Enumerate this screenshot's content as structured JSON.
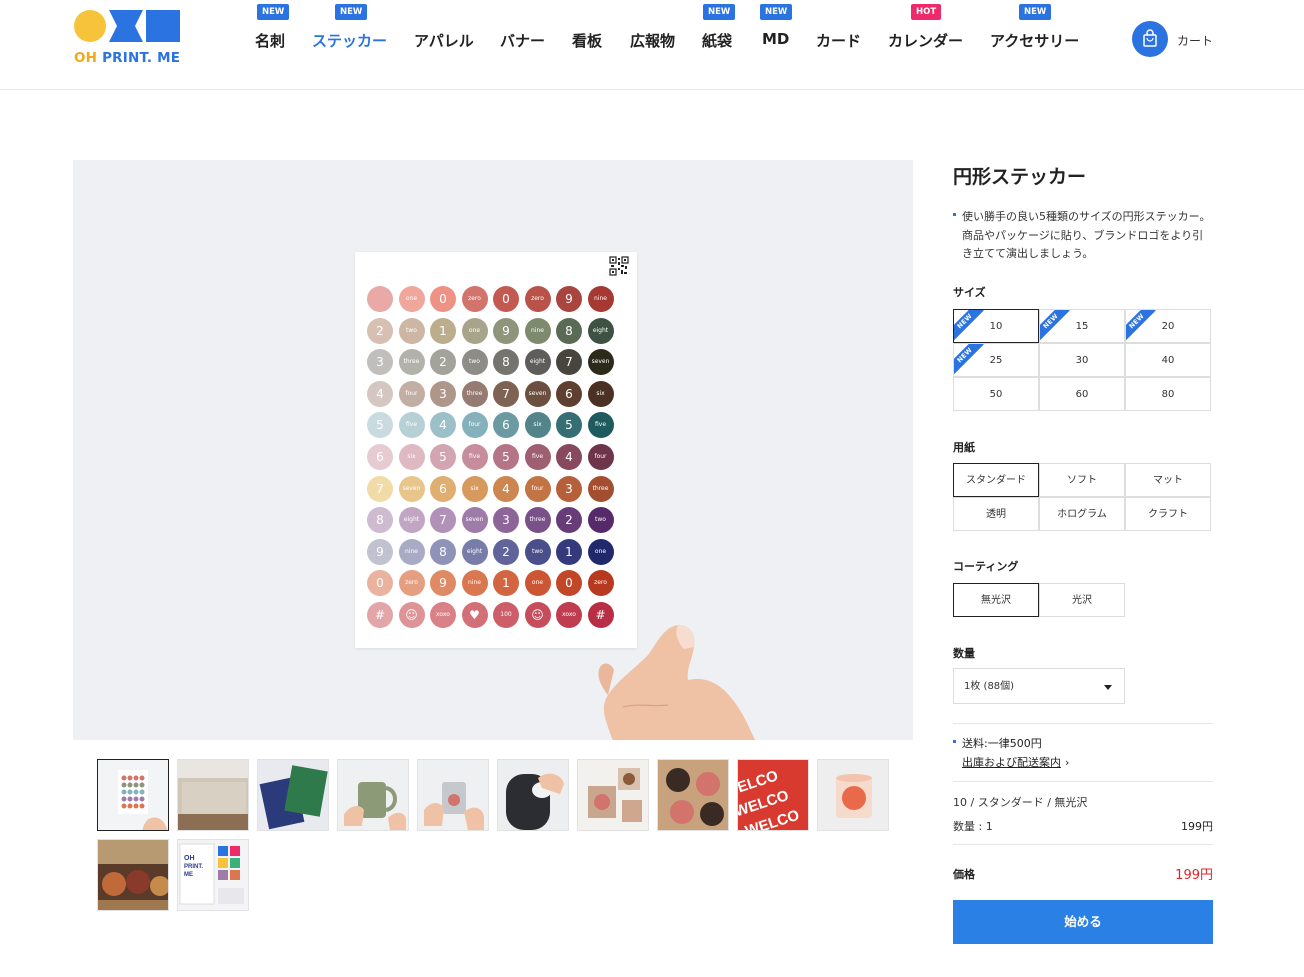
{
  "header": {
    "logo": {
      "oh": "OH ",
      "printme": "PRINT. ME"
    },
    "nav": [
      {
        "label": "名刺",
        "badge": "NEW"
      },
      {
        "label": "ステッカー",
        "badge": "NEW",
        "active": true
      },
      {
        "label": "アパレル",
        "badge": ""
      },
      {
        "label": "バナー",
        "badge": ""
      },
      {
        "label": "看板",
        "badge": ""
      },
      {
        "label": "広報物",
        "badge": ""
      },
      {
        "label": "紙袋",
        "badge": "NEW"
      },
      {
        "label": "MD",
        "badge": "NEW"
      },
      {
        "label": "カード",
        "badge": ""
      },
      {
        "label": "カレンダー",
        "badge": "HOT"
      },
      {
        "label": "アクセサリー",
        "badge": "NEW"
      }
    ],
    "cart_label": "カート"
  },
  "product": {
    "title": "円形ステッカー",
    "description": "使い勝手の良い5種類のサイズの円形ステッカー。商品やパッケージに貼り、ブランドロゴをより引き立てて演出しましょう。",
    "size_label": "サイズ",
    "sizes": [
      {
        "label": "10",
        "new": true,
        "selected": true
      },
      {
        "label": "15",
        "new": true
      },
      {
        "label": "20",
        "new": true
      },
      {
        "label": "25",
        "new": true
      },
      {
        "label": "30"
      },
      {
        "label": "40"
      },
      {
        "label": "50"
      },
      {
        "label": "60"
      },
      {
        "label": "80"
      }
    ],
    "paper_label": "用紙",
    "papers": [
      {
        "label": "スタンダード",
        "selected": true
      },
      {
        "label": "ソフト"
      },
      {
        "label": "マット"
      },
      {
        "label": "透明"
      },
      {
        "label": "ホログラム"
      },
      {
        "label": "クラフト"
      }
    ],
    "coating_label": "コーティング",
    "coatings": [
      {
        "label": "無光沢",
        "selected": true
      },
      {
        "label": "光沢"
      }
    ],
    "quantity_label": "数量",
    "quantity_value": "1枚 (88個)",
    "shipping_text": "送料:一律500円",
    "shipping_link": "出庫および配送案内",
    "summary": "10 / スタンダード / 無光沢",
    "qty_line": "数量 : 1",
    "qty_price": "199円",
    "price_label": "価格",
    "price_value": "199円",
    "start_button": "始める"
  },
  "sticker_sheet": {
    "rows": [
      {
        "colors": [
          "#e9a9a6",
          "#efa79b",
          "#ee9286",
          "#d2736c",
          "#c25a52",
          "#b95248",
          "#a8453e",
          "#a63a33"
        ],
        "labels": [
          "",
          "one",
          "0",
          "zero",
          "0",
          "zero",
          "9",
          "nine"
        ]
      },
      {
        "colors": [
          "#d7c0b1",
          "#cdb7a4",
          "#bcae8c",
          "#a8a48b",
          "#8f957b",
          "#7d8a6e",
          "#5a6b55",
          "#3e5244"
        ],
        "labels": [
          "2",
          "two",
          "1",
          "one",
          "9",
          "nine",
          "8",
          "eight"
        ]
      },
      {
        "colors": [
          "#c0bfbc",
          "#b2b2ab",
          "#a3a39b",
          "#8d8c86",
          "#76746f",
          "#5f5d59",
          "#48453f",
          "#2b2a1b"
        ],
        "labels": [
          "3",
          "three",
          "2",
          "two",
          "8",
          "eight",
          "7",
          "seven"
        ]
      },
      {
        "colors": [
          "#d4c6c0",
          "#c3aea4",
          "#ae968b",
          "#957b72",
          "#7e6254",
          "#6c4f40",
          "#5d402f",
          "#4b3123"
        ],
        "labels": [
          "4",
          "four",
          "3",
          "three",
          "7",
          "seven",
          "6",
          "six"
        ]
      },
      {
        "colors": [
          "#c9dbdf",
          "#b6d0d5",
          "#9cc0c8",
          "#84b1bb",
          "#6b9aa3",
          "#52848a",
          "#356e74",
          "#1f5a5f"
        ],
        "labels": [
          "5",
          "five",
          "4",
          "four",
          "6",
          "six",
          "5",
          "five"
        ]
      },
      {
        "colors": [
          "#e6ccd2",
          "#deb9c2",
          "#d3a4b1",
          "#c68d9d",
          "#b57586",
          "#9f5f73",
          "#88495f",
          "#6e354a"
        ],
        "labels": [
          "6",
          "six",
          "5",
          "five",
          "5",
          "five",
          "4",
          "four"
        ]
      },
      {
        "colors": [
          "#f1dca8",
          "#e8c58a",
          "#dfae70",
          "#d79a5e",
          "#cd8650",
          "#c37444",
          "#b5603a",
          "#a34e31"
        ],
        "labels": [
          "7",
          "seven",
          "6",
          "six",
          "4",
          "four",
          "3",
          "three"
        ]
      },
      {
        "colors": [
          "#cfbbd0",
          "#c1a6c4",
          "#b191b7",
          "#9f7ba8",
          "#8d6599",
          "#7a5089",
          "#683c79",
          "#562a68"
        ],
        "labels": [
          "8",
          "eight",
          "7",
          "seven",
          "3",
          "three",
          "2",
          "two"
        ]
      },
      {
        "colors": [
          "#c1c2d0",
          "#a9abc5",
          "#8f93b8",
          "#787ca9",
          "#60649a",
          "#4a4e8b",
          "#353a7c",
          "#22286c"
        ],
        "labels": [
          "9",
          "nine",
          "8",
          "eight",
          "2",
          "two",
          "1",
          "one"
        ]
      },
      {
        "colors": [
          "#e9b39d",
          "#e59e80",
          "#df8a65",
          "#d97750",
          "#d36640",
          "#cc5633",
          "#c24728",
          "#b7391f"
        ],
        "labels": [
          "0",
          "zero",
          "9",
          "nine",
          "1",
          "one",
          "0",
          "zero"
        ]
      },
      {
        "colors": [
          "#e2a6a8",
          "#de9396",
          "#d98186",
          "#d36f77",
          "#cd5e69",
          "#c74d5c",
          "#c03d50",
          "#b82e45"
        ],
        "labels": [
          "#",
          "☺",
          "xoxo",
          "♥",
          "100",
          "☺",
          "xoxo",
          "#"
        ]
      }
    ]
  },
  "thumbnails": [
    {
      "label": "sticker-sheet",
      "active": true
    },
    {
      "label": "bag"
    },
    {
      "label": "cards"
    },
    {
      "label": "mug"
    },
    {
      "label": "cup"
    },
    {
      "label": "case"
    },
    {
      "label": "table"
    },
    {
      "label": "labels"
    },
    {
      "label": "welcome"
    },
    {
      "label": "candle"
    },
    {
      "label": "jam"
    },
    {
      "label": "booklet"
    }
  ]
}
